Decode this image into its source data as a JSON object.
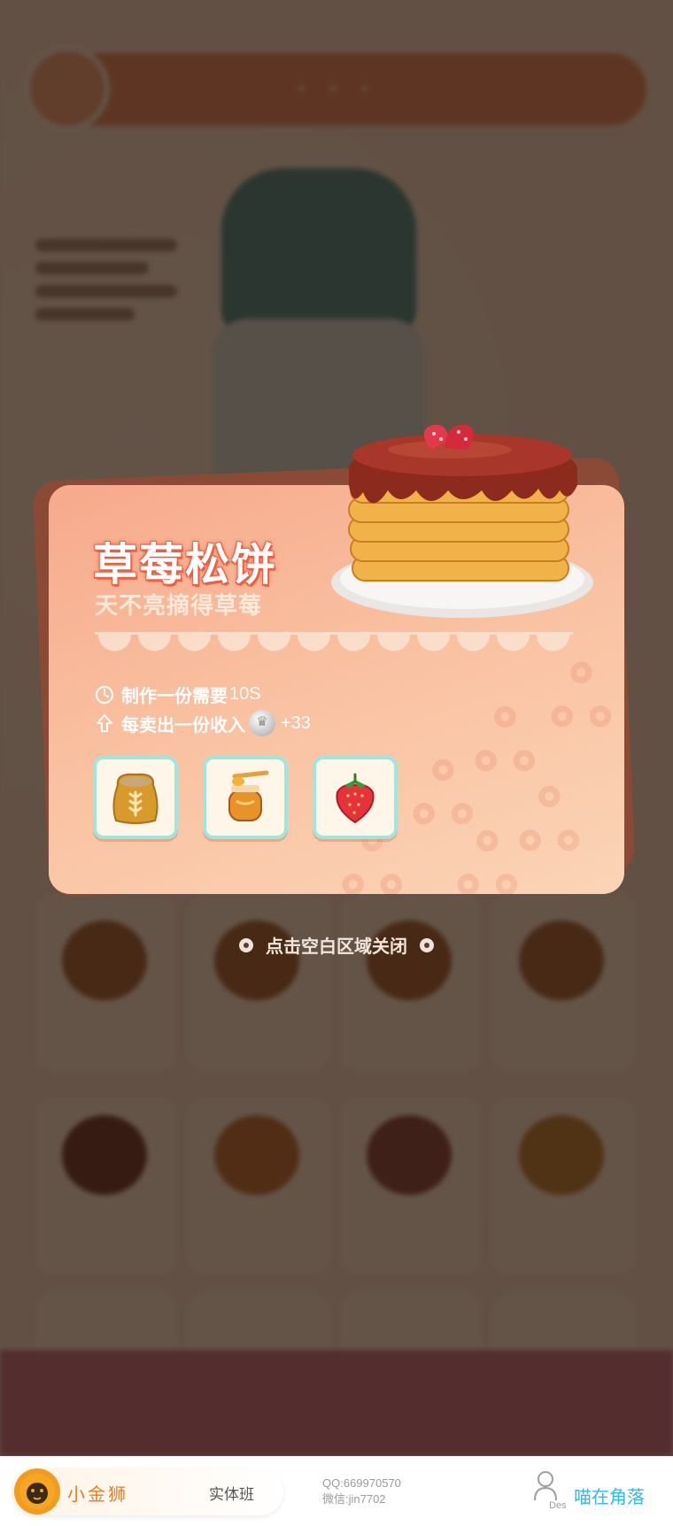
{
  "popup": {
    "title": "草莓松饼",
    "subtitle": "天不亮摘得草莓",
    "make_time_label": "制作一份需要",
    "make_time_value": "10S",
    "income_label": "每卖出一份收入",
    "income_value": "+33",
    "ingredients": [
      {
        "name": "flour-sack-icon"
      },
      {
        "name": "honey-jar-icon"
      },
      {
        "name": "strawberry-icon"
      }
    ]
  },
  "close_hint": "点击空白区域关闭",
  "footer": {
    "brand": "小金狮",
    "class_label": "实体班",
    "qq": "QQ:669970570",
    "wechat": "微信:jin7702",
    "des": "Des",
    "author": "喵在角落"
  },
  "colors": {
    "popup_bg": "#f9c0a0",
    "title_stroke": "#e9654a",
    "ingredient_border": "#9fe6dc",
    "overlay": "rgba(40,22,12,0.72)"
  }
}
